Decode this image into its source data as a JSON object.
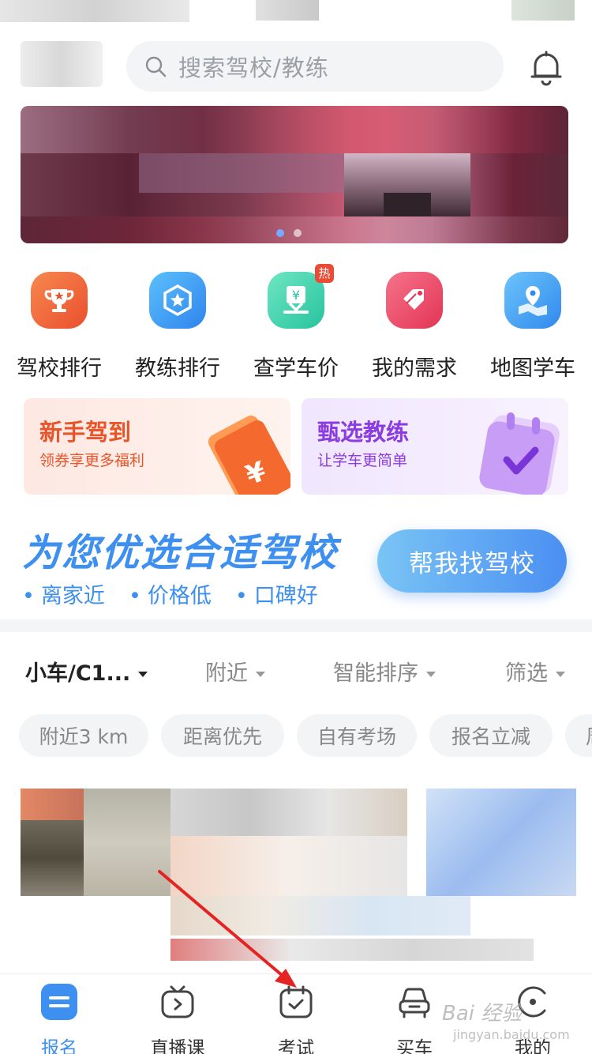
{
  "search": {
    "placeholder": "搜索驾校/教练"
  },
  "quick_entries": [
    {
      "label": "驾校排行",
      "icon": "trophy-icon",
      "color": "#f0643a"
    },
    {
      "label": "教练排行",
      "icon": "badge-star-icon",
      "color": "#3c9bf1"
    },
    {
      "label": "查学车价",
      "icon": "price-download-icon",
      "color": "#38d1b0",
      "hot_badge": "热"
    },
    {
      "label": "我的需求",
      "icon": "tag-icon",
      "color": "#ef4a6b"
    },
    {
      "label": "地图学车",
      "icon": "map-pin-icon",
      "color": "#3da1f1"
    }
  ],
  "promos": [
    {
      "title": "新手驾到",
      "subtitle": "领券享更多福利",
      "title_color": "#e8552a",
      "sub_color": "#e8552a"
    },
    {
      "title": "甄选教练",
      "subtitle": "让学车更简单",
      "title_color": "#8a3ce0",
      "sub_color": "#8a3ce0"
    }
  ],
  "slogan": {
    "headline": "为您优选合适驾校",
    "points": [
      "离家近",
      "价格低",
      "口碑好"
    ],
    "button": "帮我找驾校"
  },
  "filters": {
    "vehicle": "小车/C1...",
    "nearby": "附近",
    "sort": "智能排序",
    "screen": "筛选"
  },
  "chips": [
    "附近3 km",
    "距离优先",
    "自有考场",
    "报名立减",
    "周"
  ],
  "tabs": [
    {
      "label": "报名",
      "icon": "signup-icon",
      "active": true
    },
    {
      "label": "直播课",
      "icon": "tv-play-icon",
      "active": false
    },
    {
      "label": "考试",
      "icon": "exam-check-icon",
      "active": false
    },
    {
      "label": "买车",
      "icon": "car-icon",
      "active": false
    },
    {
      "label": "我的",
      "icon": "profile-icon",
      "active": false
    }
  ],
  "watermark": {
    "brand": "Bai 经验",
    "url": "jingyan.baidu.com"
  }
}
